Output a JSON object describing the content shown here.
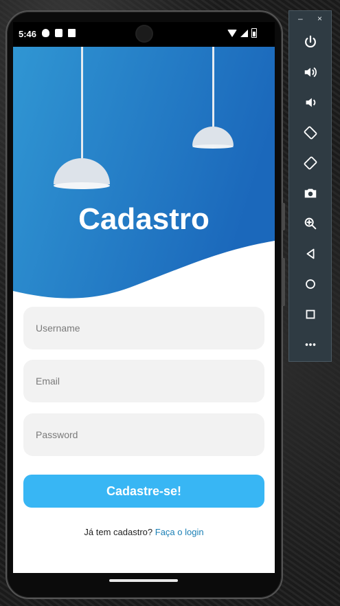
{
  "status_bar": {
    "time": "5:46"
  },
  "screen": {
    "title": "Cadastro",
    "username_placeholder": "Username",
    "email_placeholder": "Email",
    "password_placeholder": "Password",
    "submit_label": "Cadastre-se!",
    "login_prompt": "Já tem cadastro?",
    "login_link": "Faça o login"
  },
  "colors": {
    "header_gradient_start": "#2f8fd0",
    "header_gradient_end": "#1c6bbd",
    "submit_button": "#38b6f4",
    "link": "#1a7fb5",
    "field_background": "#f2f2f2"
  },
  "emulator_toolbar": {
    "items": [
      "power-icon",
      "volume-up-icon",
      "volume-down-icon",
      "rotate-left-icon",
      "rotate-right-icon",
      "camera-icon",
      "zoom-icon",
      "back-icon",
      "home-icon",
      "overview-icon",
      "more-icon"
    ],
    "minimize_symbol": "–",
    "close_symbol": "×"
  }
}
